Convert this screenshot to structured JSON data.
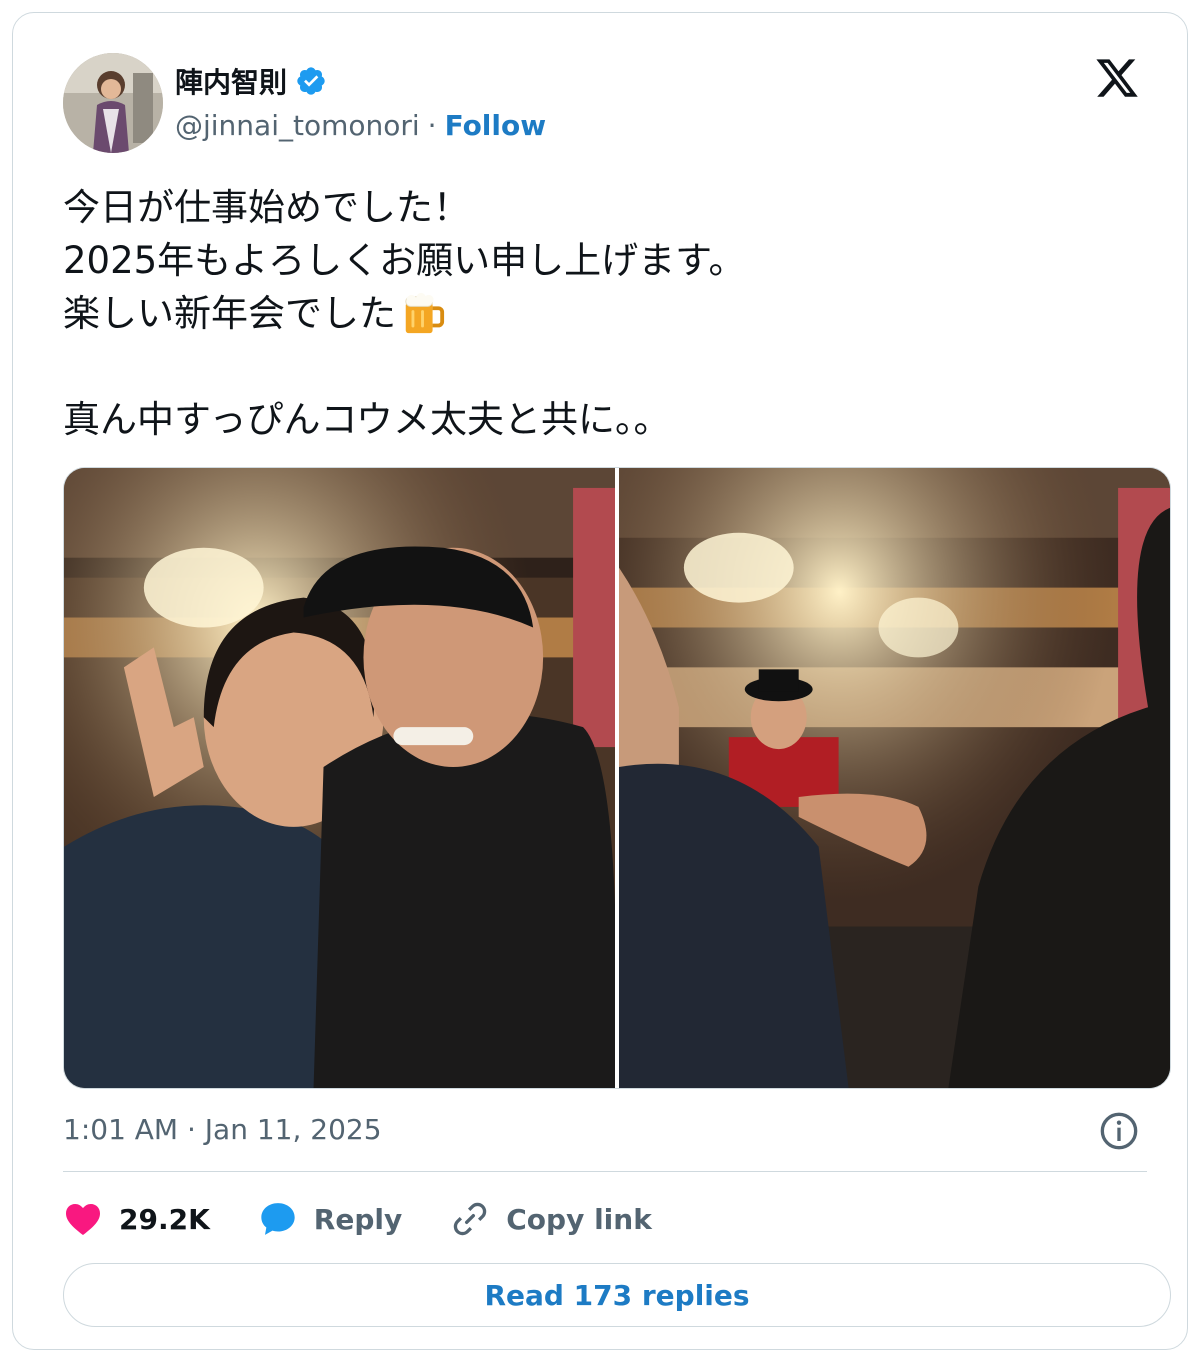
{
  "author": {
    "display_name": "陣内智則",
    "handle": "@jinnai_tomonori",
    "separator": "·",
    "follow_label": "Follow"
  },
  "tweet": {
    "lines": [
      "今日が仕事始めでした！",
      "2025年もよろしくお願い申し上げます。",
      "楽しい新年会でした",
      "",
      "真ん中すっぴんコウメ太夫と共に。。"
    ],
    "emoji": "beer-mug-icon"
  },
  "timestamp": "1:01 AM · Jan 11, 2025",
  "actions": {
    "like_count": "29.2K",
    "reply_label": "Reply",
    "copy_link_label": "Copy link"
  },
  "read_replies_label": "Read 173 replies",
  "colors": {
    "accent": "#1d7bc4",
    "like": "#f91880",
    "reply": "#1d9bf0",
    "secondary_text": "#536471",
    "border": "#cfd9de"
  }
}
